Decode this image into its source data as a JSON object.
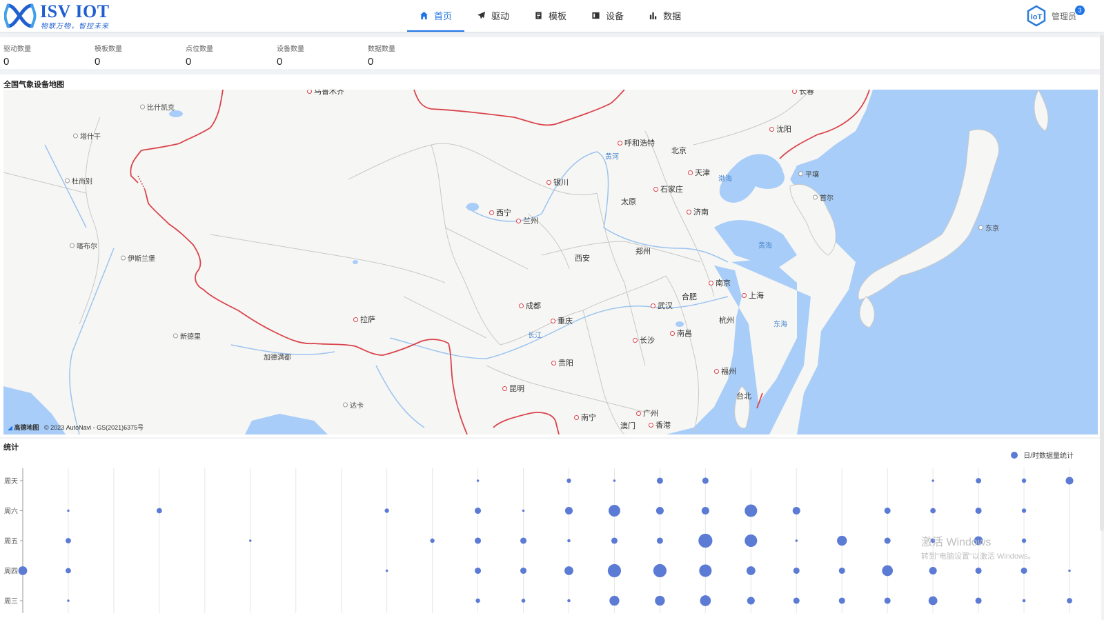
{
  "header": {
    "logo_title": "ISV IOT",
    "logo_slogan": "物联万物，智控未来",
    "nav": [
      {
        "label": "首页",
        "icon": "home-icon",
        "active": true
      },
      {
        "label": "驱动",
        "icon": "send-icon",
        "active": false
      },
      {
        "label": "模板",
        "icon": "file-icon",
        "active": false
      },
      {
        "label": "设备",
        "icon": "device-icon",
        "active": false
      },
      {
        "label": "数据",
        "icon": "bar-chart-icon",
        "active": false
      }
    ],
    "user_name": "管理员",
    "notification_count": "3"
  },
  "stats": [
    {
      "label": "驱动数量",
      "value": "0"
    },
    {
      "label": "模板数量",
      "value": "0"
    },
    {
      "label": "点位数量",
      "value": "0"
    },
    {
      "label": "设备数量",
      "value": "0"
    },
    {
      "label": "数据数量",
      "value": "0"
    }
  ],
  "map": {
    "title": "全国气象设备地图",
    "copyright_brand": "高德地图",
    "copyright_text": "© 2023 AutoNavi - GS(2021)6375号",
    "cities": [
      "乌鲁木齐",
      "长春",
      "沈阳",
      "呼和浩特",
      "北京",
      "天津",
      "石家庄",
      "太原",
      "银川",
      "西宁",
      "兰州",
      "济南",
      "郑州",
      "西安",
      "南京",
      "合肥",
      "上海",
      "武汉",
      "杭州",
      "成都",
      "重庆",
      "拉萨",
      "长沙",
      "南昌",
      "贵阳",
      "福州",
      "台北",
      "昆明",
      "南宁",
      "广州",
      "澳门",
      "香港"
    ],
    "foreign_cities": [
      "比什凯克",
      "塔什干",
      "杜尚别",
      "喀布尔",
      "伊斯兰堡",
      "新德里",
      "加德满都",
      "达卡",
      "平壤",
      "首尔",
      "东京"
    ],
    "water_labels": [
      "黄河",
      "渤海",
      "黄海",
      "东海",
      "长江"
    ]
  },
  "chart": {
    "title": "统计",
    "legend": "日/时数据量统计",
    "color": "#5b7bd5"
  },
  "chart_data": {
    "type": "scatter",
    "title": "统计",
    "series": [
      {
        "name": "日/时数据量统计"
      }
    ],
    "y_categories": [
      "周三",
      "周四",
      "周五",
      "周六",
      "周天"
    ],
    "x_count": 24,
    "points": [
      [
        0,
        "周四",
        4
      ],
      [
        1,
        "周三",
        0.3
      ],
      [
        1,
        "周四",
        1.5
      ],
      [
        1,
        "周五",
        1.5
      ],
      [
        1,
        "周六",
        0.3
      ],
      [
        3,
        "周六",
        1.5
      ],
      [
        5,
        "周五",
        0.3
      ],
      [
        8,
        "周四",
        0.3
      ],
      [
        8,
        "周六",
        1
      ],
      [
        9,
        "周五",
        1
      ],
      [
        10,
        "周三",
        1
      ],
      [
        10,
        "周四",
        2
      ],
      [
        10,
        "周五",
        2
      ],
      [
        10,
        "周六",
        2
      ],
      [
        10,
        "周天",
        0.3
      ],
      [
        11,
        "周三",
        0.8
      ],
      [
        11,
        "周四",
        2
      ],
      [
        11,
        "周五",
        2
      ],
      [
        11,
        "周六",
        0.3
      ],
      [
        12,
        "周三",
        0.5
      ],
      [
        12,
        "周四",
        4
      ],
      [
        12,
        "周五",
        0.5
      ],
      [
        12,
        "周六",
        3
      ],
      [
        12,
        "周天",
        1
      ],
      [
        13,
        "周三",
        5
      ],
      [
        13,
        "周四",
        9
      ],
      [
        13,
        "周五",
        2
      ],
      [
        13,
        "周六",
        7
      ],
      [
        13,
        "周天",
        0.3
      ],
      [
        14,
        "周三",
        5
      ],
      [
        14,
        "周四",
        9
      ],
      [
        14,
        "周五",
        2
      ],
      [
        14,
        "周六",
        3
      ],
      [
        14,
        "周天",
        2
      ],
      [
        15,
        "周三",
        6
      ],
      [
        15,
        "周四",
        8
      ],
      [
        15,
        "周五",
        10
      ],
      [
        15,
        "周六",
        3
      ],
      [
        15,
        "周天",
        2
      ],
      [
        16,
        "周三",
        3
      ],
      [
        16,
        "周四",
        4
      ],
      [
        16,
        "周五",
        8
      ],
      [
        16,
        "周六",
        8
      ],
      [
        17,
        "周三",
        2
      ],
      [
        17,
        "周四",
        2
      ],
      [
        17,
        "周五",
        0.3
      ],
      [
        17,
        "周六",
        3
      ],
      [
        18,
        "周三",
        2
      ],
      [
        18,
        "周四",
        2
      ],
      [
        18,
        "周五",
        5
      ],
      [
        19,
        "周三",
        2
      ],
      [
        19,
        "周四",
        6
      ],
      [
        19,
        "周五",
        2
      ],
      [
        19,
        "周六",
        2
      ],
      [
        20,
        "周三",
        4
      ],
      [
        20,
        "周四",
        3
      ],
      [
        20,
        "周五",
        1
      ],
      [
        20,
        "周六",
        1.5
      ],
      [
        20,
        "周天",
        0.3
      ],
      [
        21,
        "周三",
        2
      ],
      [
        21,
        "周四",
        2
      ],
      [
        21,
        "周五",
        4
      ],
      [
        21,
        "周六",
        2
      ],
      [
        21,
        "周天",
        1.5
      ],
      [
        22,
        "周三",
        0.5
      ],
      [
        22,
        "周四",
        2
      ],
      [
        22,
        "周五",
        1
      ],
      [
        22,
        "周六",
        1
      ],
      [
        22,
        "周天",
        1
      ],
      [
        23,
        "周三",
        1.5
      ],
      [
        23,
        "周四",
        0.3
      ],
      [
        23,
        "周天",
        3
      ]
    ]
  },
  "watermark": {
    "line1": "激活 Windows",
    "line2": "转到\"电脑设置\"以激活 Windows。"
  }
}
